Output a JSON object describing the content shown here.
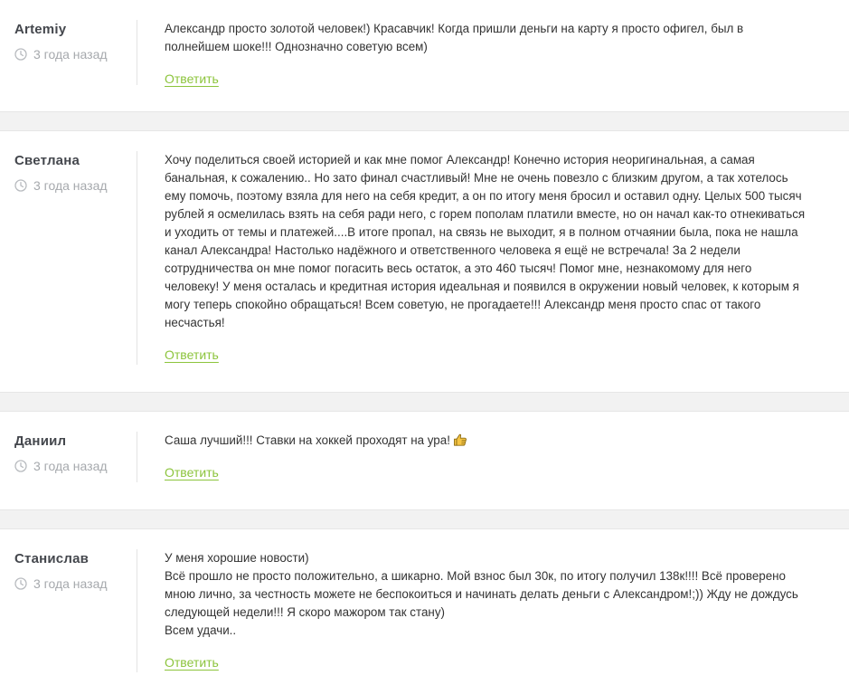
{
  "comments": [
    {
      "author": "Artemiy",
      "time": "3 года назад",
      "text": "Александр просто золотой человек!) Красавчик! Когда пришли деньги на карту я просто офигел, был в\nполнейшем шоке!!! Однозначно советую всем)",
      "reply_label": "Ответить"
    },
    {
      "author": "Светлана",
      "time": "3 года назад",
      "text": "Хочу поделиться своей историей и как мне помог Александр! Конечно история неоригинальная, а самая\nбанальная, к сожалению.. Но зато финал счастливый! Мне не очень повезло с близким другом, а так хотелось\nему помочь, поэтому взяла для него на себя кредит, а он по итогу меня бросил и оставил одну. Целых 500 тысяч\nрублей я осмелилась взять на себя ради него, с горем пополам платили вместе, но он начал как-то отнекиваться\nи уходить от темы и платежей....В итоге пропал, на связь не выходит, я в полном отчаянии была, пока не нашла\nканал Александра! Настолько надёжного и ответственного человека я ещё не встречала! За 2 недели\nсотрудничества он мне помог погасить весь остаток, а это 460 тысяч! Помог мне, незнакомому для него\nчеловеку! У меня осталась и кредитная история идеальная и появился в окружении новый человек, к которым я\nмогу теперь спокойно обращаться! Всем советую, не прогадаете!!! Александр меня просто спас от такого\nнесчастья!",
      "reply_label": "Ответить"
    },
    {
      "author": "Даниил",
      "time": "3 года назад",
      "text": "Саша лучший!!! Ставки на хоккей проходят на ура!",
      "emoji": "thumbs-up-icon",
      "reply_label": "Ответить"
    },
    {
      "author": "Станислав",
      "time": "3 года назад",
      "text": "У меня хорошие новости)\nВсё прошло не просто положительно, а шикарно. Мой взнос был 30к, по итогу получил 138к!!!! Всё проверено\nмною лично, за честность можете не беспокоиться и начинать делать деньги с Александром!;)) Жду не дождусь\nследующей недели!!! Я скоро мажором так стану)\nВсем удачи..",
      "reply_label": "Ответить"
    }
  ],
  "colors": {
    "author": "#44474d",
    "time": "#a6a9ad",
    "text": "#333333",
    "reply_link": "#8cc43c",
    "separator_band": "#f2f2f2"
  },
  "icons": {
    "time": "clock-icon",
    "emoji": "thumbs-up-icon"
  }
}
